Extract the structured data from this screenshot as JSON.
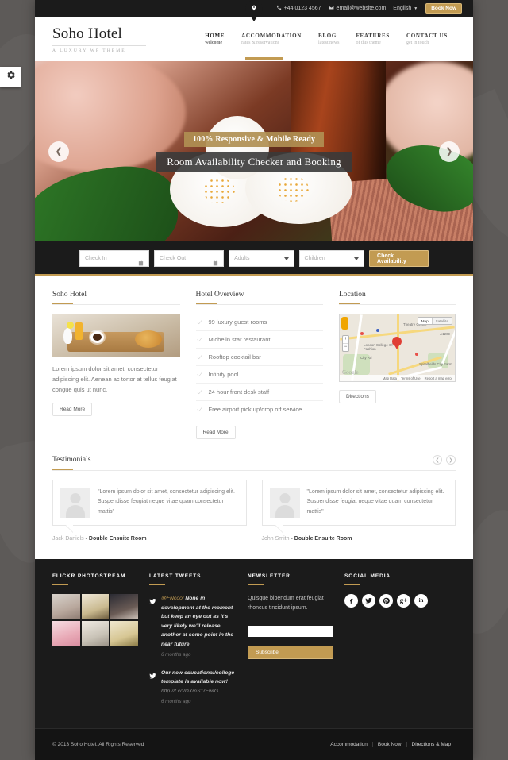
{
  "topbar": {
    "phone": "+44 0123 4567",
    "email": "email@website.com",
    "language": "English",
    "book_now": "Book Now",
    "phone_icon": "phone-icon",
    "email_icon": "envelope-icon",
    "pin_icon": "map-pin-icon"
  },
  "brand": {
    "title": "Soho Hotel",
    "tagline": "A LUXURY WP THEME"
  },
  "nav": [
    {
      "label": "HOME",
      "sub": "welcome",
      "active": true
    },
    {
      "label": "ACCOMMODATION",
      "sub": "rates & reservations",
      "active": false
    },
    {
      "label": "BLOG",
      "sub": "latest news",
      "active": false
    },
    {
      "label": "FEATURES",
      "sub": "of this theme",
      "active": false
    },
    {
      "label": "CONTACT US",
      "sub": "get in touch",
      "active": false
    }
  ],
  "hero": {
    "caption_top": "100% Responsive & Mobile Ready",
    "caption_main": "Room Availability Checker and Booking",
    "prev_icon": "chevron-left-icon",
    "next_icon": "chevron-right-icon"
  },
  "booking": {
    "check_in_placeholder": "Check In",
    "check_out_placeholder": "Check Out",
    "adults_value": "Adults",
    "children_value": "Children",
    "submit_label": "Check Availability",
    "calendar_icon": "calendar-icon"
  },
  "columns": {
    "about": {
      "heading": "Soho Hotel",
      "body": "Lorem ipsum dolor sit amet, consectetur adipiscing elit. Aenean ac tortor at tellus feugiat congue quis ut nunc.",
      "button": "Read More"
    },
    "overview": {
      "heading": "Hotel Overview",
      "items": [
        "99 luxury guest rooms",
        "Michelin star restaurant",
        "Rooftop cocktail bar",
        "Infinity pool",
        "24 hour front desk staff",
        "Free airport pick up/drop off service"
      ],
      "button": "Read More"
    },
    "location": {
      "heading": "Location",
      "button": "Directions",
      "map": {
        "type_map": "Map",
        "type_satellite": "Satellite",
        "zoom_in": "+",
        "zoom_out": "−",
        "labels": [
          "Theatre Centre",
          "London College Of Fashion",
          "Spitalfields City Farm",
          "A1209",
          "City Rd"
        ],
        "watermark": "Google",
        "attribution": [
          "Map Data",
          "Terms of Use",
          "Report a map error"
        ]
      }
    }
  },
  "testimonials": {
    "heading": "Testimonials",
    "prev_icon": "chevron-left-icon",
    "next_icon": "chevron-right-icon",
    "items": [
      {
        "quote": "\"Lorem ipsum dolor sit amet, consectetur adipiscing elit. Suspendisse feugiat neque vitae quam consectetur mattis\"",
        "author": "Jack Daniels",
        "room": "- Double Ensuite Room"
      },
      {
        "quote": "\"Lorem ipsum dolor sit amet, consectetur adipiscing elit. Suspendisse feugiat neque vitae quam consectetur mattis\"",
        "author": "John Smith",
        "room": "- Double Ensuite Room"
      }
    ]
  },
  "footer": {
    "flickr": {
      "heading": "FLICKR PHOTOSTREAM"
    },
    "tweets": {
      "heading": "LATEST TWEETS",
      "items": [
        {
          "handle": "@FNcool",
          "text": "None in development at the moment but keep an eye out as it's very likely we'll release another at some point in the near future",
          "link": "",
          "ago": "6 months ago"
        },
        {
          "handle": "",
          "text": "Our new educational/college template is available now!",
          "link": "http://t.co/DXmS1rEwtG",
          "ago": "6 months ago"
        }
      ],
      "bird_icon": "twitter-icon"
    },
    "newsletter": {
      "heading": "NEWSLETTER",
      "text": "Quisque bibendum erat feugiat rhoncus tincidunt ipsum.",
      "input_value": "",
      "button": "Subscribe"
    },
    "social": {
      "heading": "SOCIAL MEDIA",
      "items": [
        {
          "name": "facebook-icon",
          "glyph": "f"
        },
        {
          "name": "twitter-icon",
          "glyph": "t"
        },
        {
          "name": "pinterest-icon",
          "glyph": "P"
        },
        {
          "name": "google-plus-icon",
          "glyph": "g+"
        },
        {
          "name": "linkedin-icon",
          "glyph": "in"
        }
      ]
    }
  },
  "copyright": {
    "text": "© 2013 Soho Hotel. All Rights Reserved",
    "links": [
      "Accommodation",
      "Book Now",
      "Directions & Map"
    ]
  },
  "settings_tab": {
    "icon": "gear-icon"
  },
  "colors": {
    "accent_gold": "#c29b52",
    "dark": "#1b1b1b",
    "page_bg": "#5d5a58"
  }
}
